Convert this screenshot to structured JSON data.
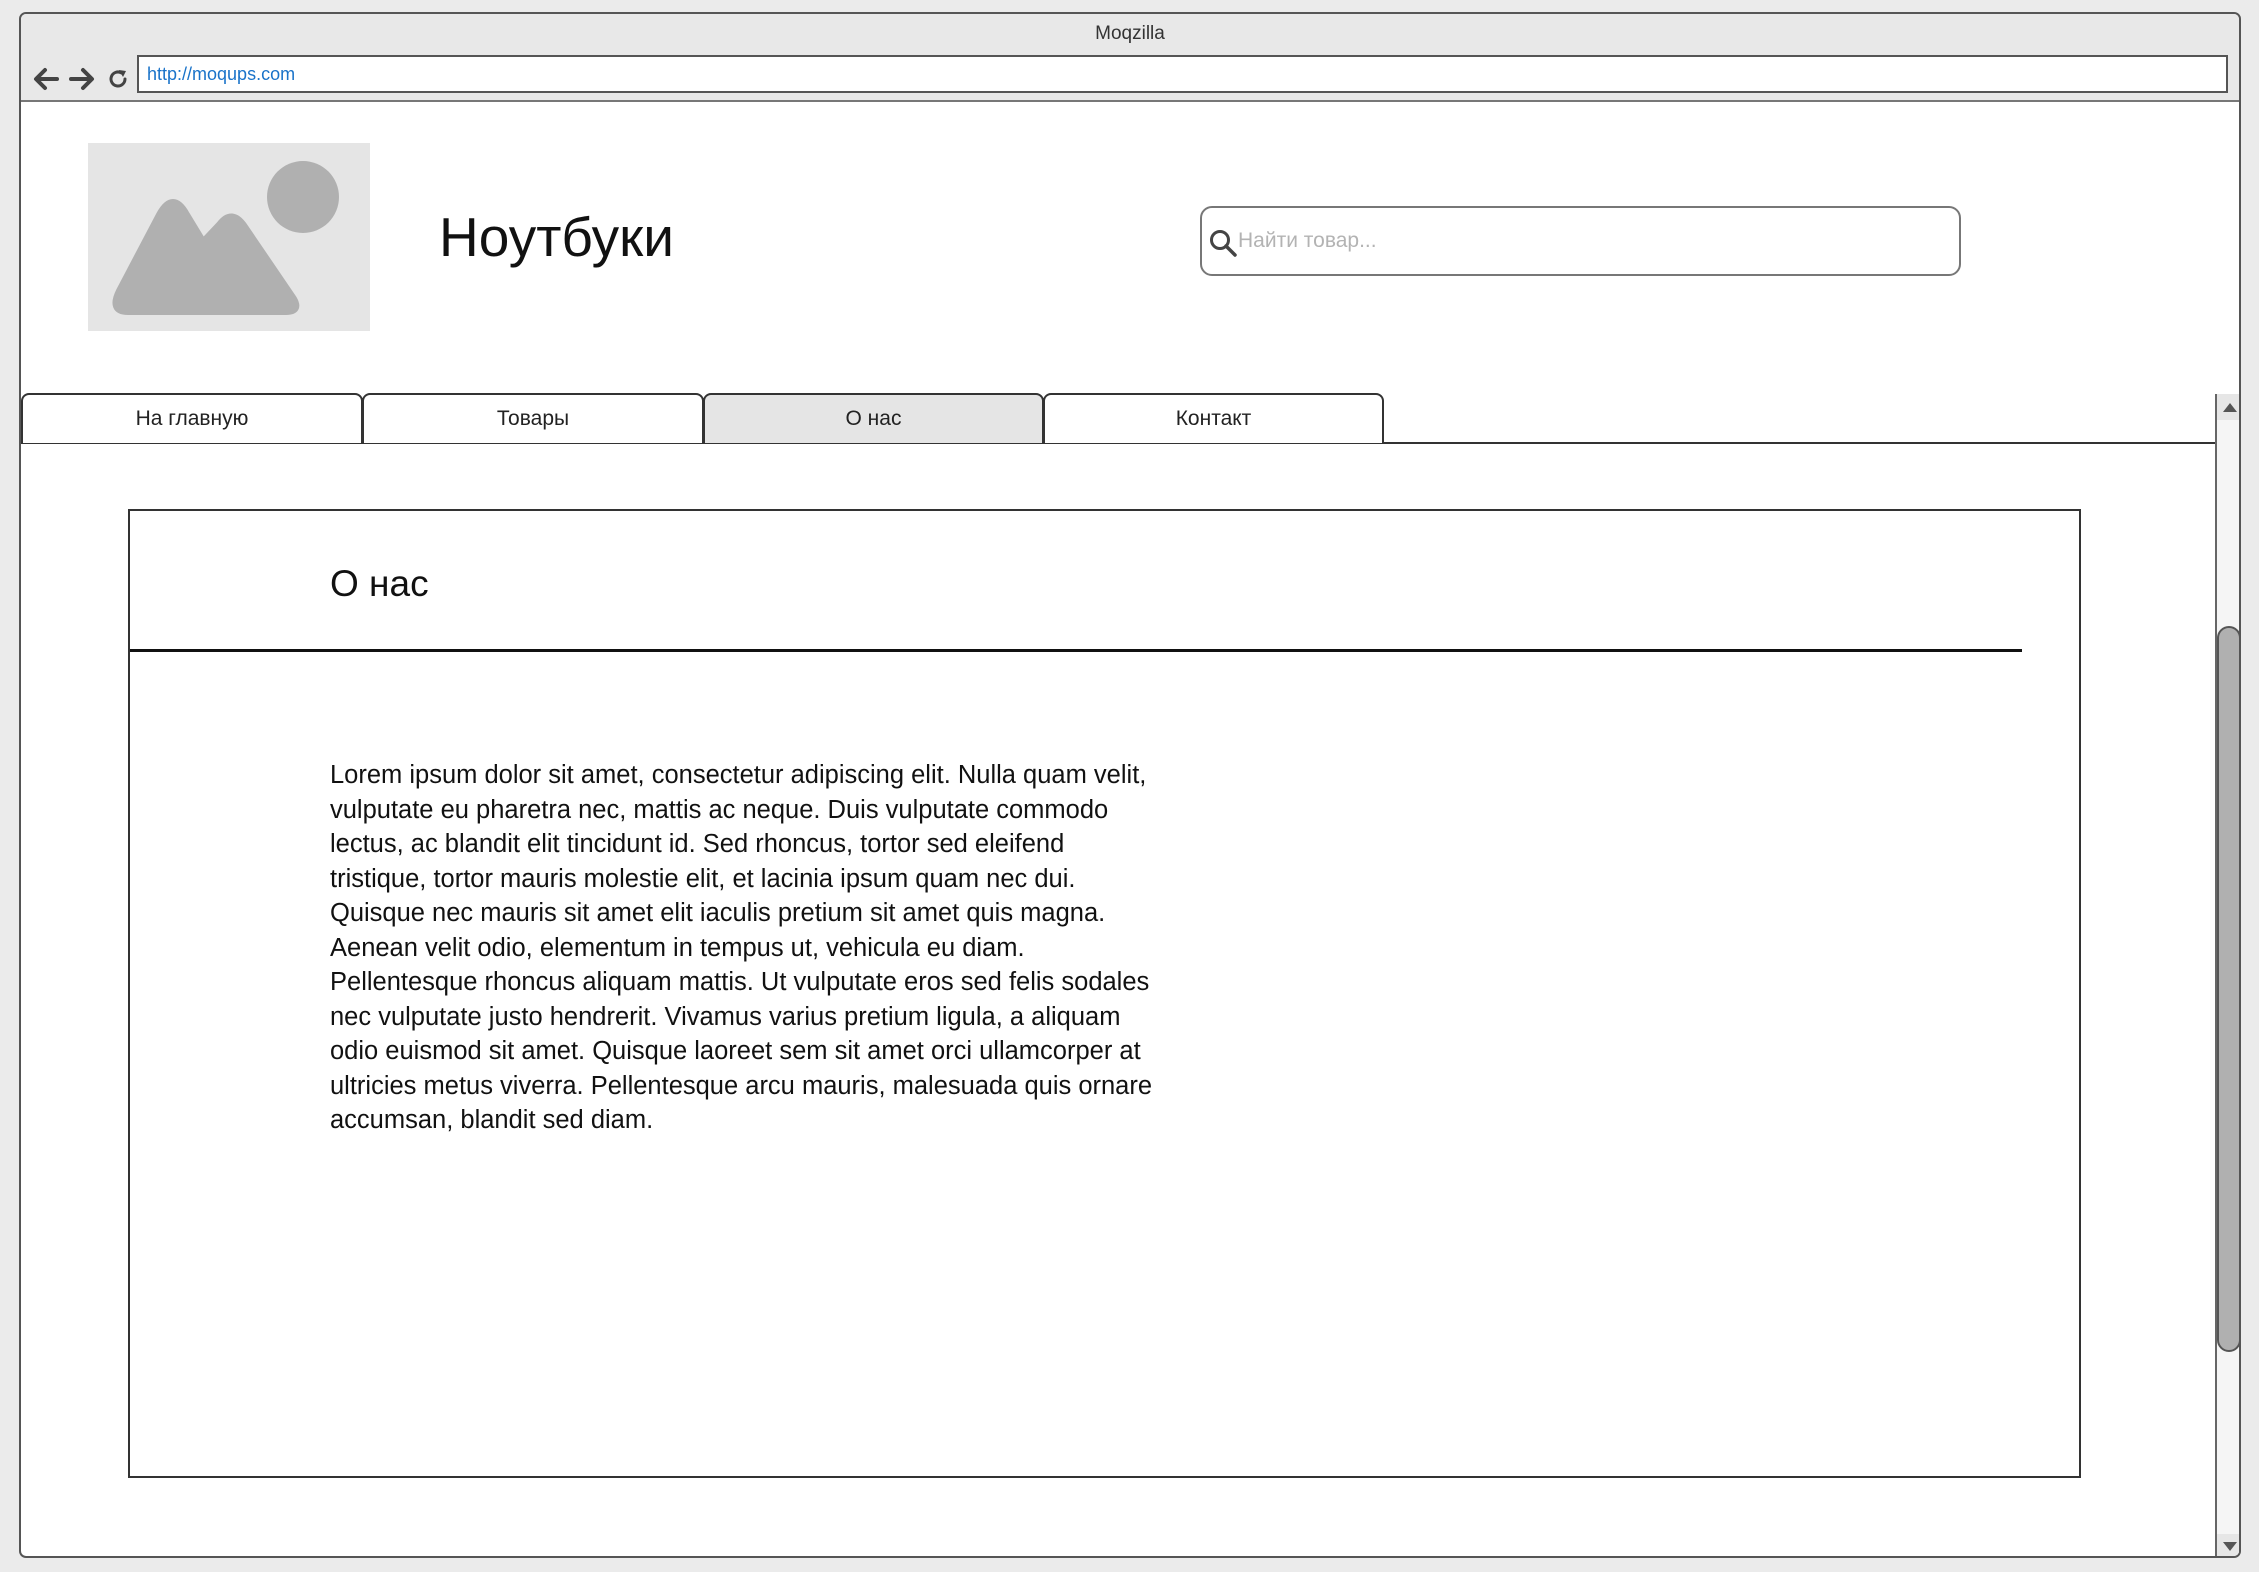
{
  "browser": {
    "title": "Moqzilla",
    "url": "http://moqups.com"
  },
  "header": {
    "site_title": "Ноутбуки",
    "search_placeholder": "Найти товар..."
  },
  "nav": {
    "tabs": [
      {
        "label": "На главную",
        "active": false
      },
      {
        "label": "Товары",
        "active": false
      },
      {
        "label": "О нас",
        "active": true
      },
      {
        "label": "Контакт",
        "active": false
      }
    ]
  },
  "main": {
    "heading": "О нас",
    "body_text": "Lorem ipsum dolor sit amet, consectetur adipiscing elit. Nulla quam velit, vulputate eu pharetra nec, mattis ac neque. Duis vulputate commodo lectus, ac blandit elit tincidunt id. Sed rhoncus, tortor sed eleifend tristique, tortor mauris molestie elit, et lacinia ipsum quam nec dui. Quisque nec mauris sit amet elit iaculis pretium sit amet quis magna. Aenean velit odio, elementum in tempus ut, vehicula eu diam. Pellentesque rhoncus aliquam mattis. Ut vulputate eros sed felis sodales nec vulputate justo hendrerit. Vivamus varius pretium ligula, a aliquam odio euismod sit amet. Quisque laoreet sem sit amet orci ullamcorper at ultricies metus viverra. Pellentesque arcu mauris, malesuada quis ornare accumsan, blandit sed diam."
  },
  "icons": {
    "back": "arrow-left-icon",
    "forward": "arrow-right-icon",
    "reload": "reload-icon",
    "search": "search-icon",
    "logo": "image-placeholder-icon",
    "scroll_up": "triangle-up-icon",
    "scroll_down": "triangle-down-icon"
  },
  "colors": {
    "link": "#1a73c9",
    "active_tab": "#e5e5e5",
    "placeholder_image": "#e5e5e5",
    "placeholder_shape": "#b0b0b0"
  }
}
